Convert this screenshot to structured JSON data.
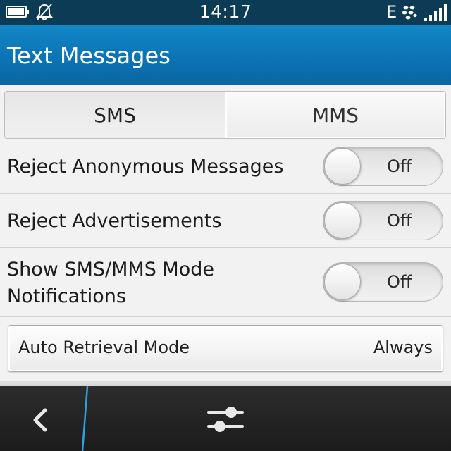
{
  "status_bar": {
    "time": "14:17",
    "network_type": "E",
    "icons": [
      "battery-icon",
      "mute-bell-icon",
      "blackberry-icon",
      "signal-icon"
    ]
  },
  "header": {
    "title": "Text Messages"
  },
  "tabs": [
    {
      "label": "SMS",
      "selected": true
    },
    {
      "label": "MMS",
      "selected": false
    }
  ],
  "settings": [
    {
      "label": "Reject Anonymous Messages",
      "state": "Off"
    },
    {
      "label": "Reject Advertisements",
      "state": "Off"
    },
    {
      "label_line1": "Show SMS/MMS Mode",
      "label_line2": "Notifications",
      "state": "Off"
    }
  ],
  "auto_retrieval": {
    "label": "Auto Retrieval Mode",
    "value": "Always"
  },
  "action_bar": {
    "icons": [
      "back-chevron-icon",
      "settings-sliders-icon"
    ]
  },
  "colors": {
    "status_bar_bg": "#0b3b55",
    "title_bar_bg": "#0b74b5",
    "accent_divider": "#2aa3e0",
    "action_bar_bg": "#222222"
  }
}
